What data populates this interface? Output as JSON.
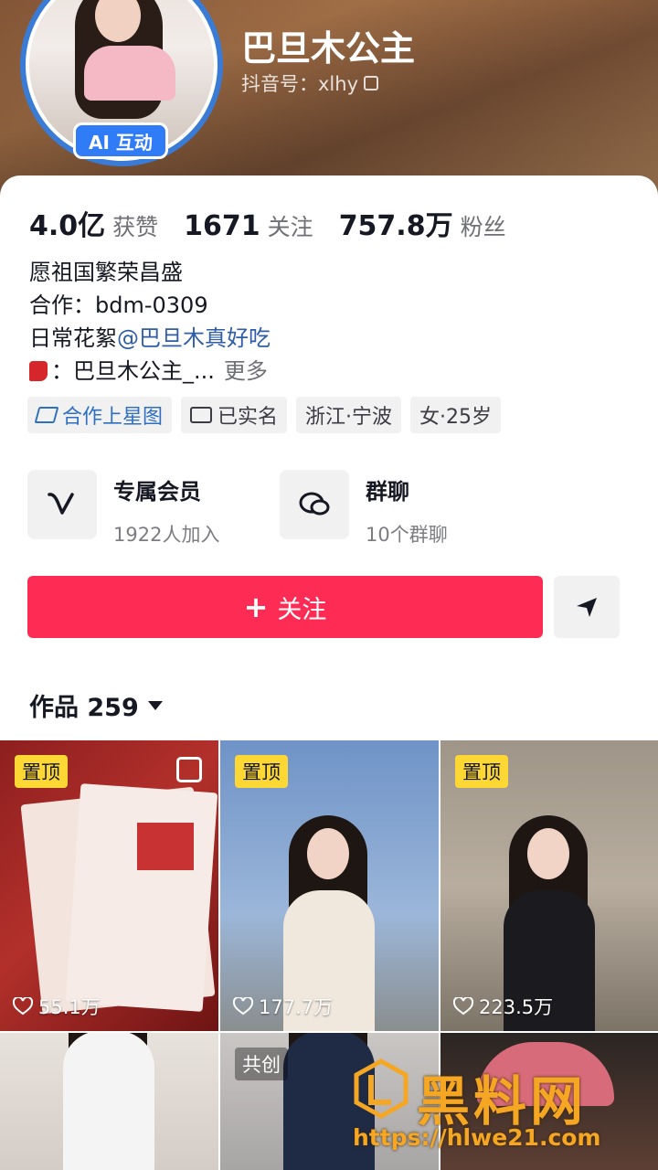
{
  "profile": {
    "ai_badge": "AI 互动",
    "nickname": "巴旦木公主",
    "douyin_id": "抖音号：xlhy"
  },
  "stats": [
    {
      "value": "4.0亿",
      "label": "获赞"
    },
    {
      "value": "1671",
      "label": "关注"
    },
    {
      "value": "757.8万",
      "label": "粉丝"
    }
  ],
  "bio": {
    "line1": "愿祖国繁荣昌盛",
    "line2": "合作：bdm-0309",
    "line3_prefix": "日常花絮",
    "line3_mention": "@巴旦木真好吃",
    "line4": "：巴旦木公主_...",
    "more": "更多"
  },
  "tags": [
    "合作上星图",
    "已实名",
    "浙江·宁波",
    "女·25岁"
  ],
  "features": [
    {
      "title": "专属会员",
      "sub": "1922人加入",
      "icon": "vip-v-icon"
    },
    {
      "title": "群聊",
      "sub": "10个群聊",
      "icon": "chat-bubble-icon"
    }
  ],
  "actions": {
    "follow": "关注",
    "share_icon": "send-icon"
  },
  "works": {
    "label": "作品 259"
  },
  "videos": [
    {
      "badge": "置顶",
      "likes": "55.1万"
    },
    {
      "badge": "置顶",
      "likes": "177.7万"
    },
    {
      "badge": "置顶",
      "likes": "223.5万"
    },
    {
      "badge": "",
      "likes": ""
    },
    {
      "badge": "共创",
      "likes": ""
    },
    {
      "badge": "",
      "likes": ""
    }
  ],
  "watermark": {
    "brand": "黑料网",
    "url": "https://hlwe21.com"
  },
  "colors": {
    "accent": "#fe2c55",
    "link": "#2f5da6",
    "pin": "#fdd835",
    "ai_badge": "#2f7cf6"
  }
}
